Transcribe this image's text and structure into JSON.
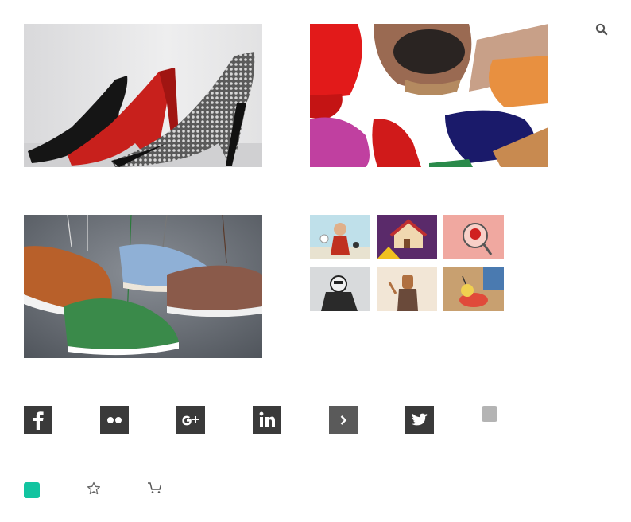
{
  "header": {
    "search_icon": "search-icon"
  },
  "gallery": {
    "images": [
      {
        "name": "high-heels-row-photo",
        "colors": [
          "#e9e9ea",
          "#c41c1c",
          "#111111",
          "#bdbdbd"
        ]
      },
      {
        "name": "colorful-shoes-pile-photo",
        "colors": [
          "#ffffff",
          "#e21a1a",
          "#b08060",
          "#1a1a6a",
          "#c040a0"
        ]
      },
      {
        "name": "hanging-sneakers-photo",
        "colors": [
          "#6d727a",
          "#b8602a",
          "#8fb0d6",
          "#8a5a4a",
          "#3a8a4a"
        ]
      }
    ],
    "thumbnails": [
      {
        "name": "illustration-thumb-1"
      },
      {
        "name": "illustration-thumb-2"
      },
      {
        "name": "illustration-thumb-3"
      },
      {
        "name": "illustration-thumb-4"
      },
      {
        "name": "illustration-thumb-5"
      },
      {
        "name": "illustration-thumb-6"
      }
    ]
  },
  "social": [
    {
      "icon": "facebook-icon"
    },
    {
      "icon": "flickr-icon"
    },
    {
      "icon": "google-plus-icon"
    },
    {
      "icon": "linkedin-icon"
    },
    {
      "icon": "chevron-right-icon"
    },
    {
      "icon": "twitter-icon"
    },
    {
      "icon": "placeholder-square-icon"
    }
  ],
  "actions": [
    {
      "icon": "teal-square-icon"
    },
    {
      "icon": "star-icon"
    },
    {
      "icon": "cart-icon"
    }
  ],
  "colors": {
    "icon_bg": "#3a3a3a",
    "accent": "#12c4a0",
    "muted": "#b4b4b4"
  }
}
